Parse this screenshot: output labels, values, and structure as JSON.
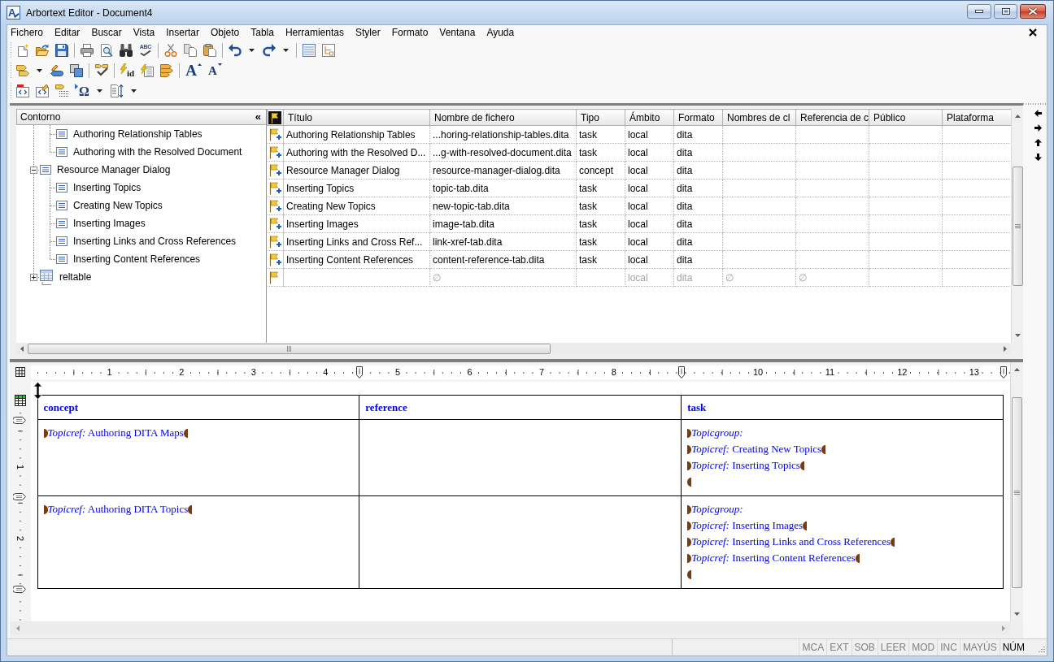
{
  "window": {
    "logo_letter": "A",
    "title": "Arbortext Editor - Document4"
  },
  "menu_bar": {
    "items": [
      "Fichero",
      "Editar",
      "Buscar",
      "Vista",
      "Insertar",
      "Objeto",
      "Tabla",
      "Herramientas",
      "Styler",
      "Formato",
      "Ventana",
      "Ayuda"
    ]
  },
  "toolbar": {
    "labeled_buttons": [
      {
        "label": "ABC"
      },
      {
        "label": "id"
      },
      {
        "label": "A"
      },
      {
        "label": "A"
      },
      {
        "label": "Ω"
      }
    ]
  },
  "outline": {
    "title": "Contorno",
    "collapse_button": "«",
    "items": [
      {
        "children": [
          {
            "kind": "topic",
            "label": "Authoring Relationship Tables"
          },
          {
            "kind": "topic",
            "label": "Authoring with the Resolved Document"
          }
        ]
      },
      {
        "kind": "topic",
        "label": "Resource Manager Dialog",
        "expanded": true,
        "children": [
          {
            "kind": "topic",
            "label": "Inserting Topics"
          },
          {
            "kind": "topic",
            "label": "Creating New Topics"
          },
          {
            "kind": "topic",
            "label": "Inserting Images"
          },
          {
            "kind": "topic",
            "label": "Inserting Links and Cross References"
          },
          {
            "kind": "topic",
            "label": "Inserting Content References"
          }
        ]
      },
      {
        "kind": "reltable",
        "label": "reltable",
        "expanded": false
      }
    ]
  },
  "map_table": {
    "columns": [
      {
        "label": "Título"
      },
      {
        "label": "Nombre de fichero"
      },
      {
        "label": "Tipo"
      },
      {
        "label": "Ámbito"
      },
      {
        "label": "Formato"
      },
      {
        "label": "Nombres de cl"
      },
      {
        "label": "Referencia de c"
      },
      {
        "label": "Público"
      },
      {
        "label": "Plataforma"
      }
    ],
    "rows": [
      {
        "kind": "topicref",
        "title": "Authoring Relationship Tables",
        "file_name": "...horing-relationship-tables.dita",
        "type": "task",
        "scope": "local",
        "format": "dita"
      },
      {
        "kind": "topicref",
        "title": "Authoring with the Resolved D...",
        "file_name": "...g-with-resolved-document.dita",
        "type": "task",
        "scope": "local",
        "format": "dita"
      },
      {
        "kind": "topicref",
        "title": "Resource Manager Dialog",
        "file_name": "resource-manager-dialog.dita",
        "type": "concept",
        "scope": "local",
        "format": "dita"
      },
      {
        "kind": "topicref",
        "title": "Inserting Topics",
        "file_name": "topic-tab.dita",
        "type": "task",
        "scope": "local",
        "format": "dita"
      },
      {
        "kind": "topicref",
        "title": "Creating New Topics",
        "file_name": "new-topic-tab.dita",
        "type": "task",
        "scope": "local",
        "format": "dita"
      },
      {
        "kind": "topicref",
        "title": "Inserting Images",
        "file_name": "image-tab.dita",
        "type": "task",
        "scope": "local",
        "format": "dita"
      },
      {
        "kind": "topicref",
        "title": "Inserting Links and Cross Ref...",
        "file_name": "link-xref-tab.dita",
        "type": "task",
        "scope": "local",
        "format": "dita"
      },
      {
        "kind": "topicref",
        "title": "Inserting Content References",
        "file_name": "content-reference-tab.dita",
        "type": "task",
        "scope": "local",
        "format": "dita"
      },
      {
        "kind": "new",
        "file_name": "∅",
        "scope": "local",
        "format": "dita",
        "column_7": "∅",
        "column_8": "∅"
      }
    ]
  },
  "ruler": {
    "marks": [
      "1",
      "2",
      "3",
      "4",
      "5",
      "6",
      "7",
      "8",
      "10",
      "11",
      "12",
      "13"
    ]
  },
  "vertical_ruler": {
    "marks": [
      "1",
      "2"
    ]
  },
  "document_table": {
    "columns": [
      {
        "label": "concept"
      },
      {
        "label": "reference"
      },
      {
        "label": "task"
      }
    ],
    "rows": [
      {
        "cells": [
          {
            "lines": [
              {
                "kind": "topicref",
                "text": "*Topicref:* Authoring DITA Maps"
              }
            ]
          },
          {},
          {
            "lines": [
              {
                "kind": "group_start",
                "text": "Topicgroup:"
              },
              {
                "kind": "topicref",
                "text": "*Topicref:* Creating New Topics"
              },
              {
                "kind": "topicref",
                "text": "*Topicref:* Inserting Topics"
              },
              {
                "kind": "group_end"
              }
            ]
          }
        ]
      },
      {
        "cells": [
          {
            "lines": [
              {
                "kind": "topicref",
                "text": "*Topicref:* Authoring DITA Topics"
              }
            ]
          },
          {},
          {
            "lines": [
              {
                "kind": "group_start",
                "text": "Topicgroup:"
              },
              {
                "kind": "topicref",
                "text": "*Topicref:* Inserting Images"
              },
              {
                "kind": "topicref",
                "text": "*Topicref:* Inserting Links and Cross References"
              },
              {
                "kind": "topicref",
                "text": "*Topicref:* Inserting Content References"
              },
              {
                "kind": "group_end"
              }
            ]
          }
        ]
      }
    ]
  },
  "status_bar": {
    "indicators": [
      {
        "label": "MCA",
        "on": false
      },
      {
        "label": "EXT",
        "on": false
      },
      {
        "label": "SOB",
        "on": false
      },
      {
        "label": "LEER",
        "on": false
      },
      {
        "label": "MOD",
        "on": false
      },
      {
        "label": "INC",
        "on": false
      },
      {
        "label": "MAYÚS",
        "on": false
      },
      {
        "label": "NÚM",
        "on": true
      }
    ]
  }
}
